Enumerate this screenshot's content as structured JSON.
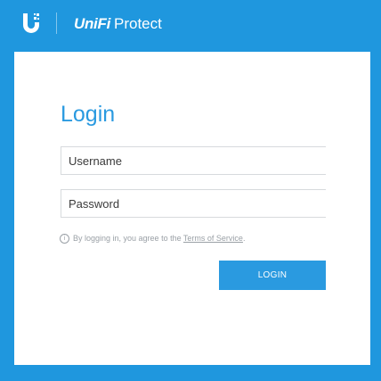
{
  "header": {
    "logo_icon": "ubiquiti-u-icon",
    "brand_prefix": "UniFi",
    "brand_suffix": "Protect"
  },
  "login": {
    "title": "Login",
    "username_placeholder": "Username",
    "password_placeholder": "Password",
    "notice_text": "By logging in, you agree to the ",
    "terms_link": "Terms of Service",
    "notice_suffix": ".",
    "button_label": "LOGIN"
  },
  "colors": {
    "background": "#1f97de",
    "accent": "#2a9ae0",
    "card": "#ffffff"
  }
}
